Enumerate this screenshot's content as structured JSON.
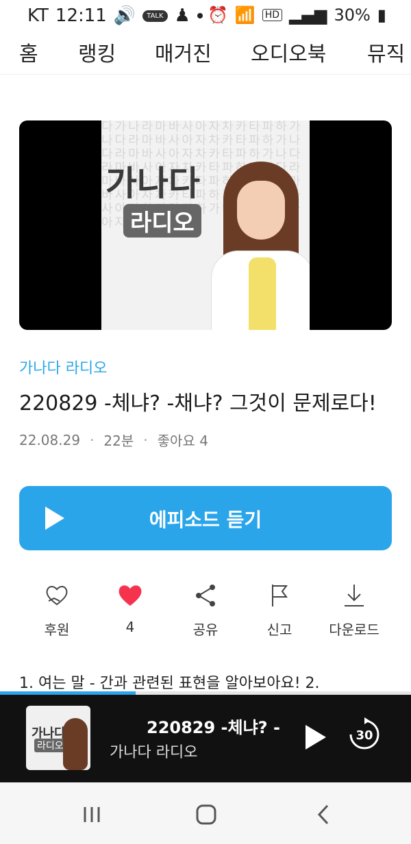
{
  "statusbar": {
    "carrier": "KT",
    "time": "12:11",
    "talk_badge": "TALK",
    "network": "HD",
    "battery": "30%"
  },
  "tabs": [
    "홈",
    "랭킹",
    "매거진",
    "오디오북",
    "뮤직"
  ],
  "cover": {
    "title": "가나다",
    "subtitle": "라디오",
    "background_text": "다가나라마바사아자차카타파하가나다라마바사아자차카타파하가나다라마바사아자차카타파하가나다라마바사아자차카타파하가나다라마바사아자차카타파하가나다라마바사아자차카타파하가나다라마바사아자차카타파하가나다라마바사아자차카타파하"
  },
  "episode": {
    "channel": "가나다 라디오",
    "title": "220829 -체냐? -채냐? 그것이 문제로다!",
    "date": "22.08.29",
    "duration": "22분",
    "likes": "좋아요 4"
  },
  "play_button": {
    "label": "에피소드 듣기"
  },
  "actions": [
    {
      "label": "후원",
      "icon": "heart-hand-icon"
    },
    {
      "label": "4",
      "icon": "heart-icon"
    },
    {
      "label": "공유",
      "icon": "share-icon"
    },
    {
      "label": "신고",
      "icon": "flag-icon"
    },
    {
      "label": "다운로드",
      "icon": "download-icon"
    }
  ],
  "description": "1. 여는 말 - 간과 관련된 표현을 알아보아요! 2.",
  "player": {
    "title": "220829 -체냐? -",
    "subtitle": "가나다 라디오",
    "forward_seconds": "30",
    "thumb_title": "가나다",
    "thumb_sub": "라디오",
    "progress": 0.33
  },
  "colors": {
    "accent": "#2ba5ea",
    "like": "#f5334d",
    "player_bg": "#111111"
  }
}
